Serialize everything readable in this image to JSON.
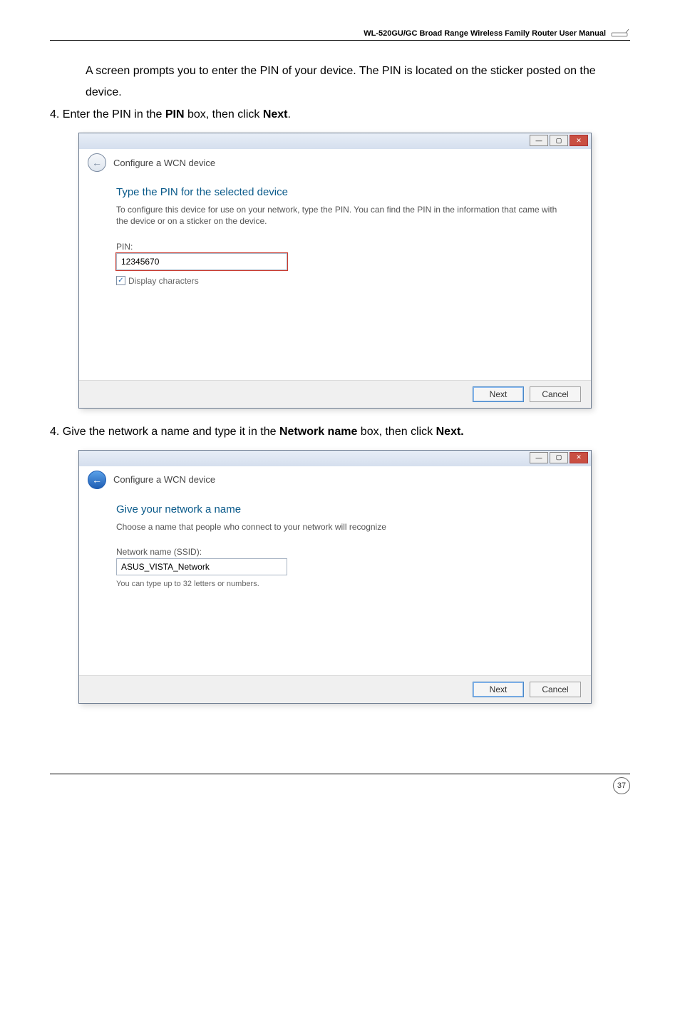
{
  "header": {
    "title": "WL-520GU/GC Broad Range Wireless Family Router User Manual"
  },
  "paragraphs": {
    "p1_prefix": "A screen prompts you to enter the PIN of your device. The PIN is located on the sticker posted on the device.",
    "p2_number": "4. ",
    "p2_a": "Enter the PIN   in the ",
    "p2_b_bold": "PIN",
    "p2_c": " box, then click ",
    "p2_d_bold": "Next",
    "p2_e": ".",
    "p3_number": "4. ",
    "p3_a": "Give the network a name and type it in the ",
    "p3_b_bold": "Network name",
    "p3_c": " box, then click ",
    "p3_d_bold": "Next.",
    "p3_e": ""
  },
  "dialog1": {
    "window_title": "Configure a WCN device",
    "heading": "Type the PIN for the selected device",
    "description": "To configure this device for use on your network, type the PIN. You can find the PIN in the information that came with the device or on a sticker on the device.",
    "pin_label": "PIN:",
    "pin_value": "12345670",
    "display_chars": "Display characters",
    "btn_next": "Next",
    "btn_cancel": "Cancel"
  },
  "dialog2": {
    "window_title": "Configure a WCN device",
    "heading": "Give your network a name",
    "description": "Choose a name that people who connect to your network will recognize",
    "ssid_label": "Network name (SSID):",
    "ssid_value": "ASUS_VISTA_Network",
    "helper": "You can type up to 32 letters or numbers.",
    "btn_next": "Next",
    "btn_cancel": "Cancel"
  },
  "footer": {
    "page_number": "37"
  }
}
